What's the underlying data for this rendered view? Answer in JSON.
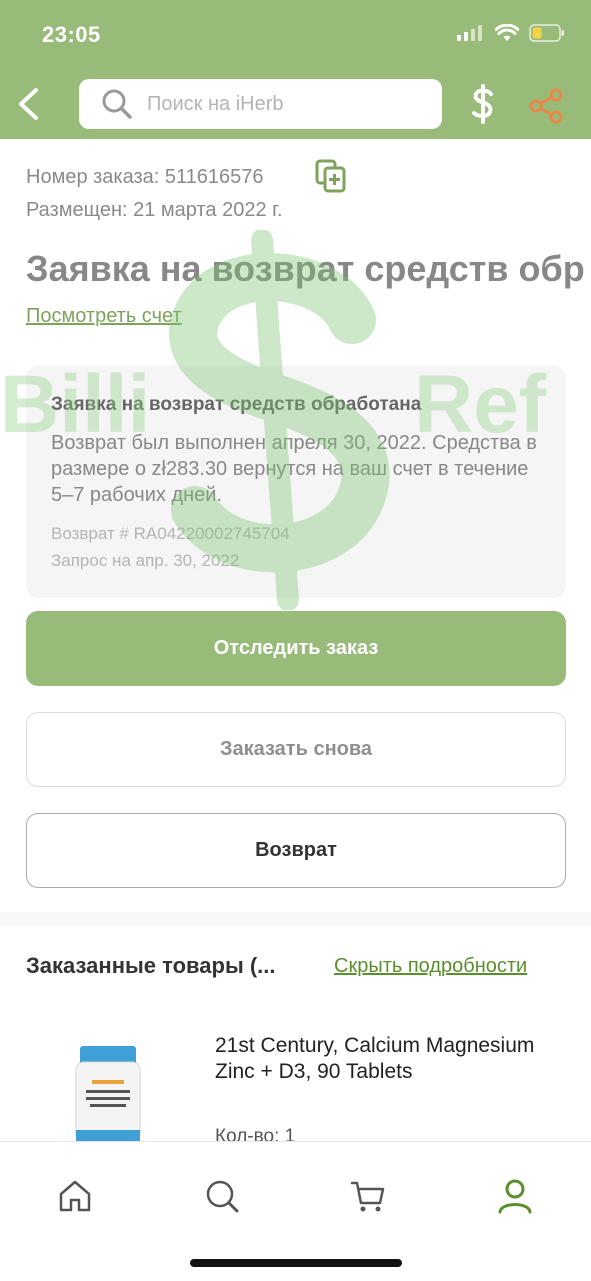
{
  "status_bar": {
    "time": "23:05"
  },
  "header": {
    "search_placeholder": "Поиск на iHerb",
    "icons": [
      "back-icon",
      "search-icon",
      "dollar-icon",
      "share-icon"
    ],
    "accent_color": "#99bb7a",
    "share_color": "#e8894a"
  },
  "order": {
    "number_label": "Номер заказа: 511616576",
    "placed_label": "Размещен: 21 марта 2022 г.",
    "title": "Заявка на возврат средств обр",
    "invoice_link": "Посмотреть счет"
  },
  "refund_card": {
    "title": "Заявка на возврат средств обработана",
    "body": "Возврат был выполнен апреля 30, 2022. Средства в размере o zł283.30 вернутся на ваш счет в течение 5–7 рабочих дней.",
    "refund_number": "Возврат # RA04220002745704",
    "request_date": "Запрос на апр. 30, 2022"
  },
  "watermark": {
    "left": "Billi",
    "right": "Ref"
  },
  "buttons": {
    "track": "Отследить заказ",
    "reorder": "Заказать снова",
    "return": "Возврат"
  },
  "items_section": {
    "title": "Заказанные товары (...",
    "toggle": "Скрыть подробности",
    "products": [
      {
        "name": "21st Century, Calcium Magnesium Zinc + D3, 90 Tablets",
        "qty": "Кол-во: 1"
      }
    ]
  },
  "tabbar": {
    "icons": [
      "home-icon",
      "search-icon",
      "cart-icon",
      "account-icon"
    ],
    "active": "account-icon"
  }
}
